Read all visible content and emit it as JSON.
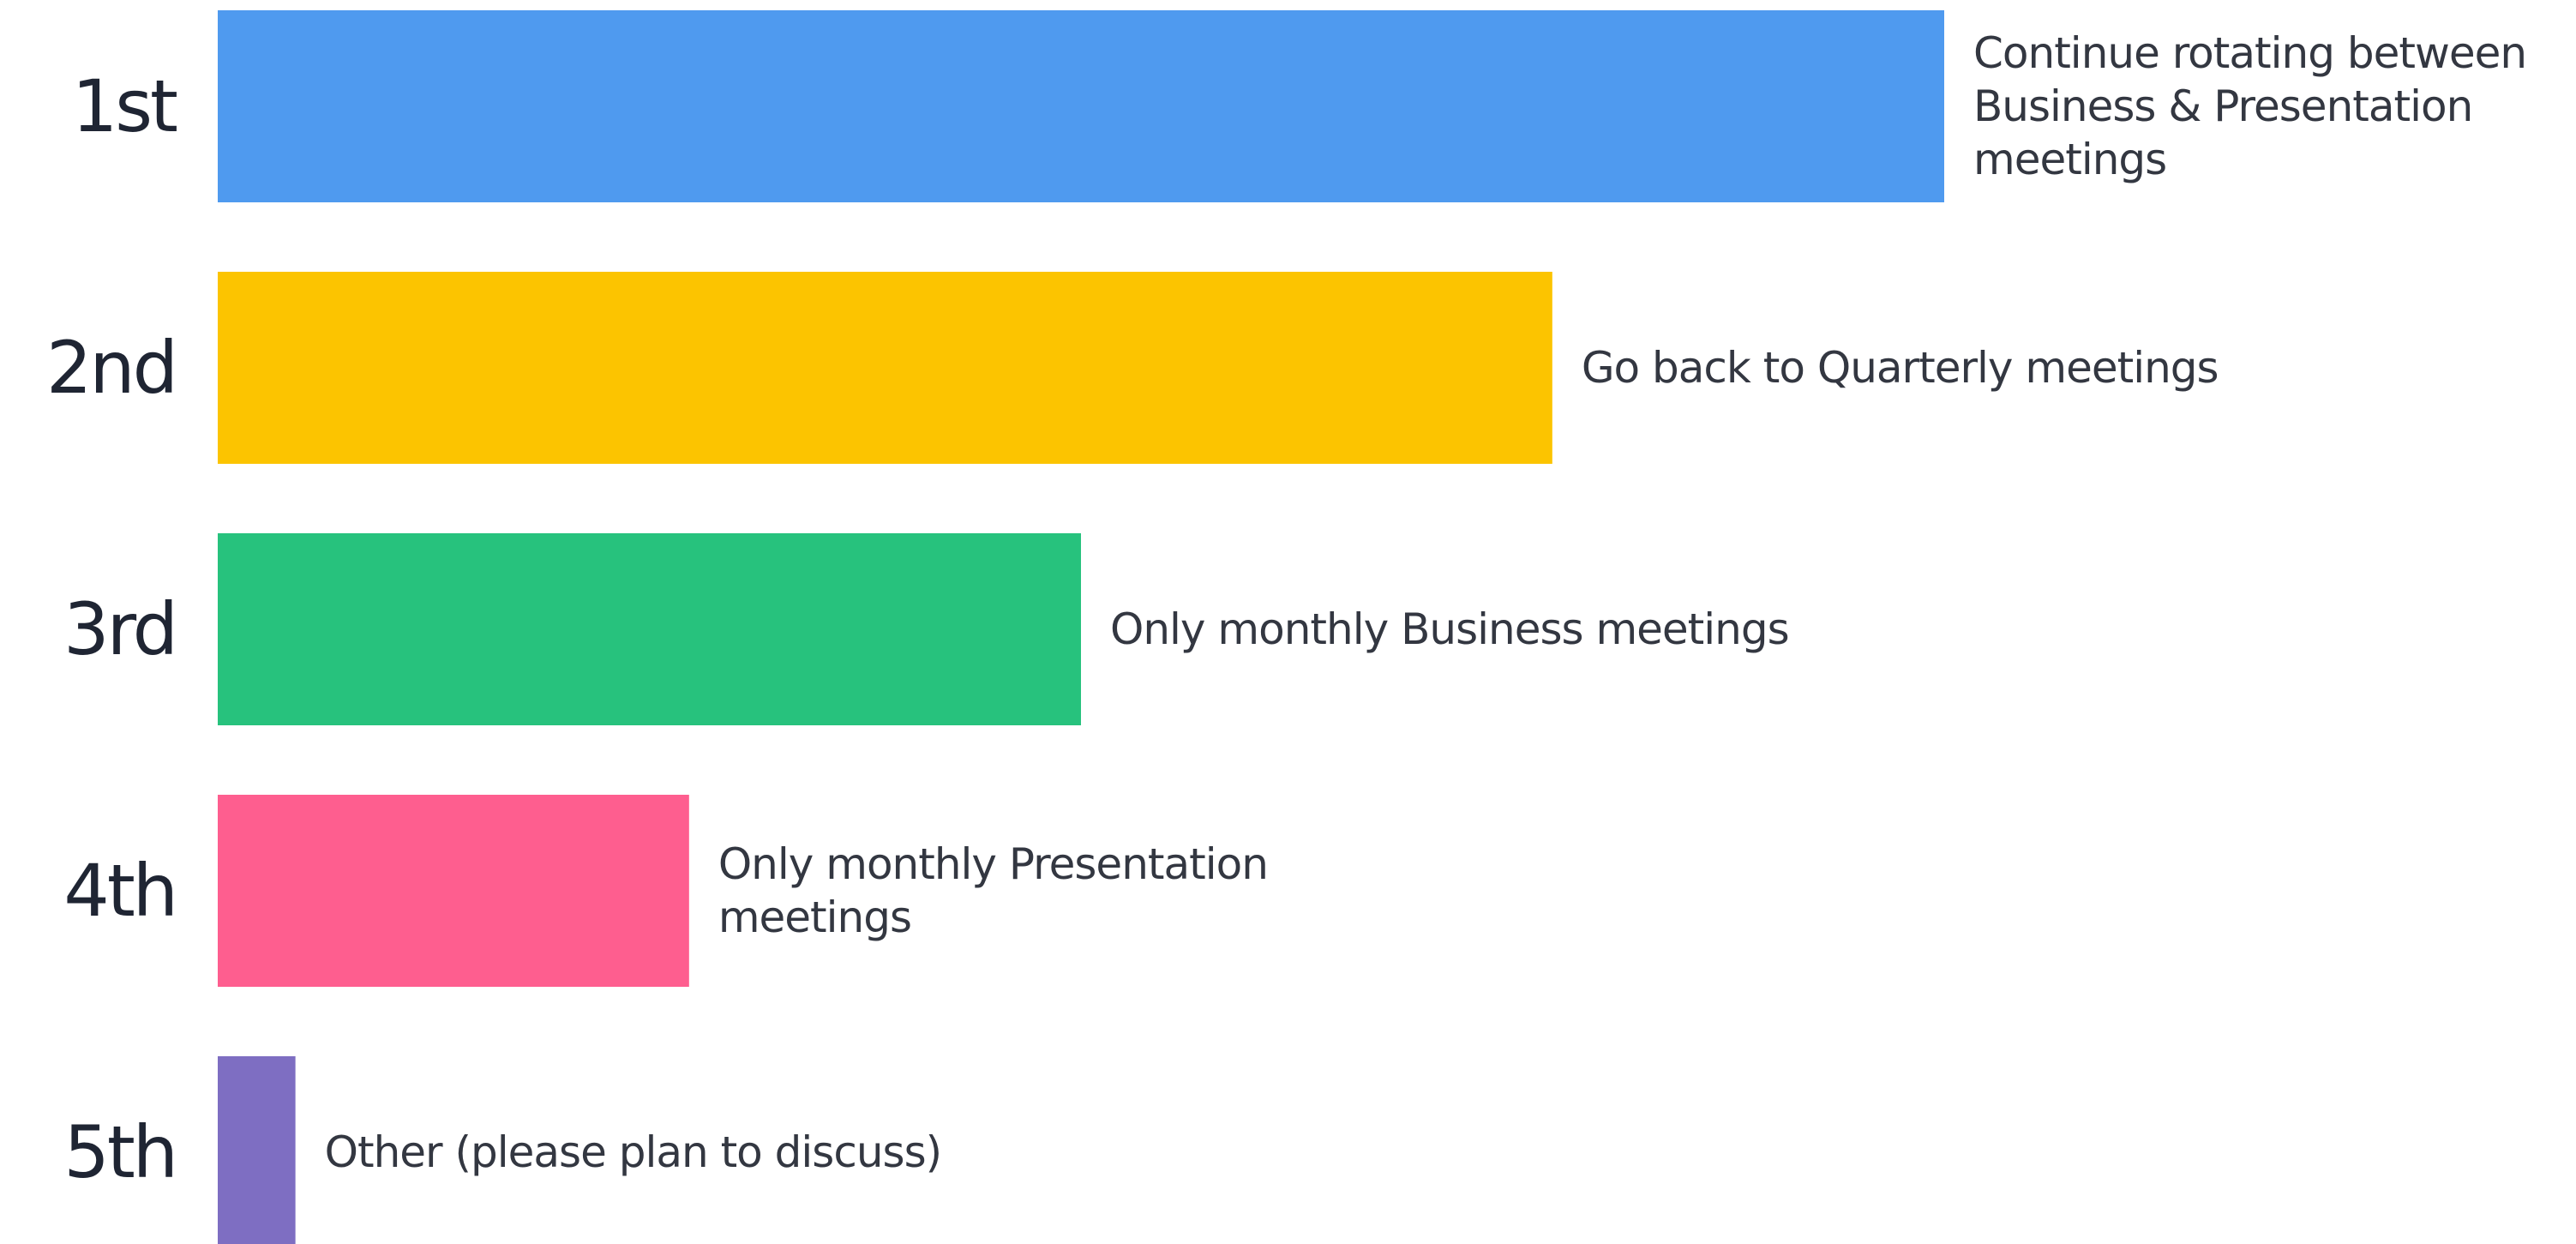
{
  "chart_data": {
    "type": "bar",
    "orientation": "horizontal",
    "categories": [
      "1st",
      "2nd",
      "3rd",
      "4th",
      "5th"
    ],
    "values": [
      100,
      77.3,
      50,
      27.3,
      4.5
    ],
    "bar_labels": [
      [
        "Continue rotating between",
        "Business & Presentation",
        "meetings"
      ],
      [
        "Go back to Quarterly meetings"
      ],
      [
        "Only monthly Business meetings"
      ],
      [
        "Only monthly Presentation",
        "meetings"
      ],
      [
        "Other (please plan to discuss)"
      ]
    ],
    "colors": [
      "#4f9aef",
      "#fcc400",
      "#27c27d",
      "#fe5e8f",
      "#7e6ec2"
    ],
    "title": "",
    "xlabel": "",
    "ylabel": "",
    "grid": false,
    "legend": "none"
  }
}
